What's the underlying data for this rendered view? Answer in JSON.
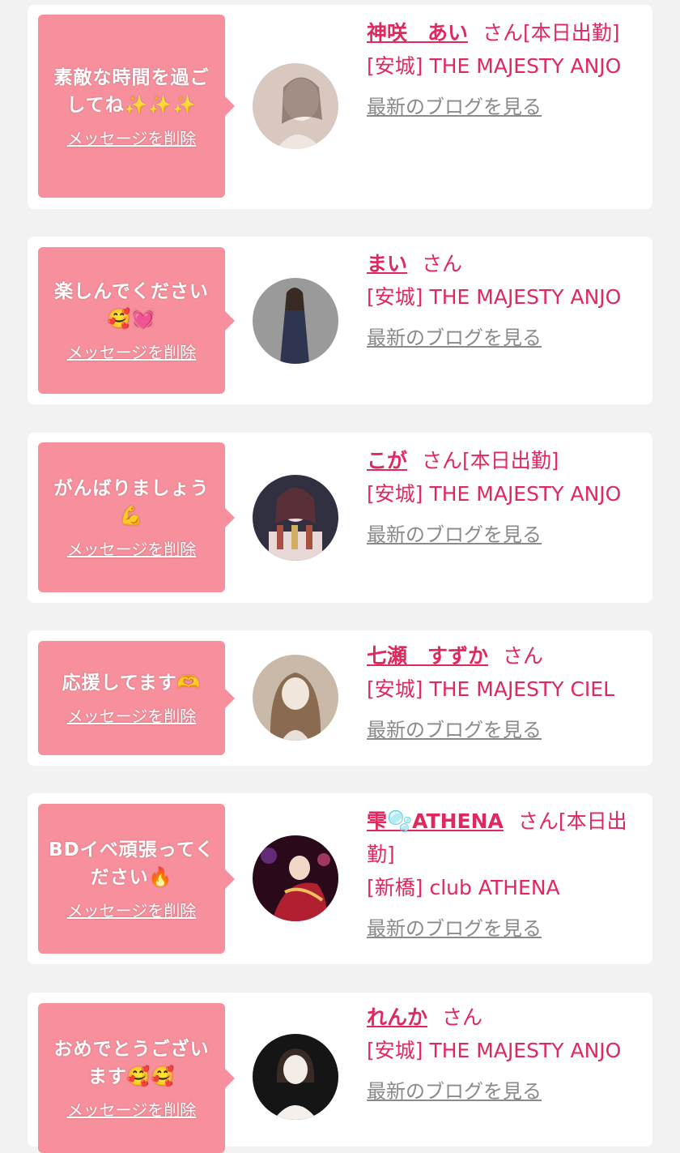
{
  "items": [
    {
      "message": "素敵な時間を過ごしてね✨✨✨",
      "delete_label": "メッセージを削除",
      "name": "神咲　あい",
      "honorific": "さん",
      "status": "[本日出勤]",
      "shop": "[安城] THE MAJESTY ANJO",
      "blog_label": "最新のブログを見る",
      "avatar_colors": [
        "#d8c8c0",
        "#f4ece6"
      ]
    },
    {
      "message": "楽しんでください🥰💓",
      "delete_label": "メッセージを削除",
      "name": "まい",
      "honorific": "さん",
      "status": "",
      "shop": "[安城] THE MAJESTY ANJO",
      "blog_label": "最新のブログを見る",
      "avatar_colors": [
        "#9a9a9a",
        "#2d3550"
      ]
    },
    {
      "message": "がんばりましょう💪",
      "delete_label": "メッセージを削除",
      "name": "こが",
      "honorific": "さん",
      "status": "[本日出勤]",
      "shop": "[安城] THE MAJESTY ANJO",
      "blog_label": "最新のブログを見る",
      "avatar_colors": [
        "#303040",
        "#e8d8d8"
      ]
    },
    {
      "message": "応援してます🫶",
      "delete_label": "メッセージを削除",
      "name": "七瀬　すずか",
      "honorific": "さん",
      "status": "",
      "shop": "[安城] THE MAJESTY CIEL",
      "blog_label": "最新のブログを見る",
      "avatar_colors": [
        "#c9b9a8",
        "#f0e6dc"
      ]
    },
    {
      "message": "BDイベ頑張ってください🔥",
      "delete_label": "メッセージを削除",
      "name": "雫🫧ATHENA",
      "honorific": "さん",
      "status": "[本日出勤]",
      "shop": "[新橋] club ATHENA",
      "blog_label": "最新のブログを見る",
      "avatar_colors": [
        "#2a0a1a",
        "#b02030"
      ]
    },
    {
      "message": "おめでとうございます🥰🥰",
      "delete_label": "メッセージを削除",
      "name": "れんか",
      "honorific": "さん",
      "status": "",
      "shop": "[安城] THE MAJESTY ANJO",
      "blog_label": "最新のブログを見る",
      "avatar_colors": [
        "#151515",
        "#f4f0ee"
      ]
    }
  ]
}
